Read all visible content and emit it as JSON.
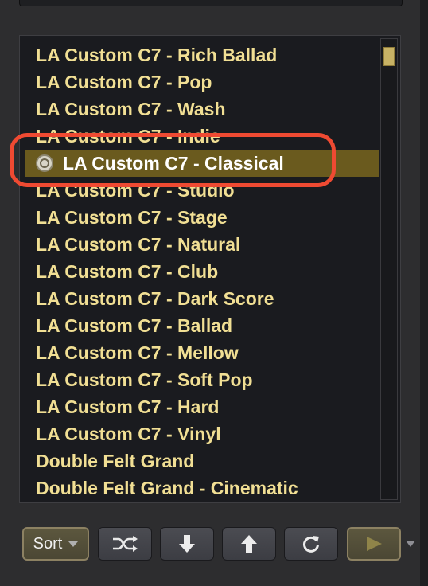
{
  "presets": [
    "LA Custom C7 - Rich Ballad",
    "LA Custom C7 - Pop",
    "LA Custom C7 - Wash",
    "LA Custom C7 - Indie",
    "LA Custom C7 - Classical",
    "LA Custom C7 - Studio",
    "LA Custom C7 - Stage",
    "LA Custom C7 - Natural",
    "LA Custom C7 - Club",
    "LA Custom C7 - Dark Score",
    "LA Custom C7 - Ballad",
    "LA Custom C7 - Mellow",
    "LA Custom C7 - Soft Pop",
    "LA Custom C7 - Hard",
    "LA Custom C7 - Vinyl",
    "Double Felt Grand",
    "Double Felt Grand - Cinematic"
  ],
  "selected_index": 4,
  "toolbar": {
    "sort_label": "Sort"
  },
  "icons": {
    "preset": "preset-icon",
    "shuffle": "shuffle-icon",
    "down": "arrow-down-icon",
    "up": "arrow-up-icon",
    "refresh": "refresh-icon",
    "play": "play-icon",
    "more": "chevron-down-icon"
  },
  "colors": {
    "item_text": "#f1df94",
    "selected_bg": "#6a5a1e",
    "annotation": "#ef4a32",
    "background": "#2d2d2f"
  }
}
